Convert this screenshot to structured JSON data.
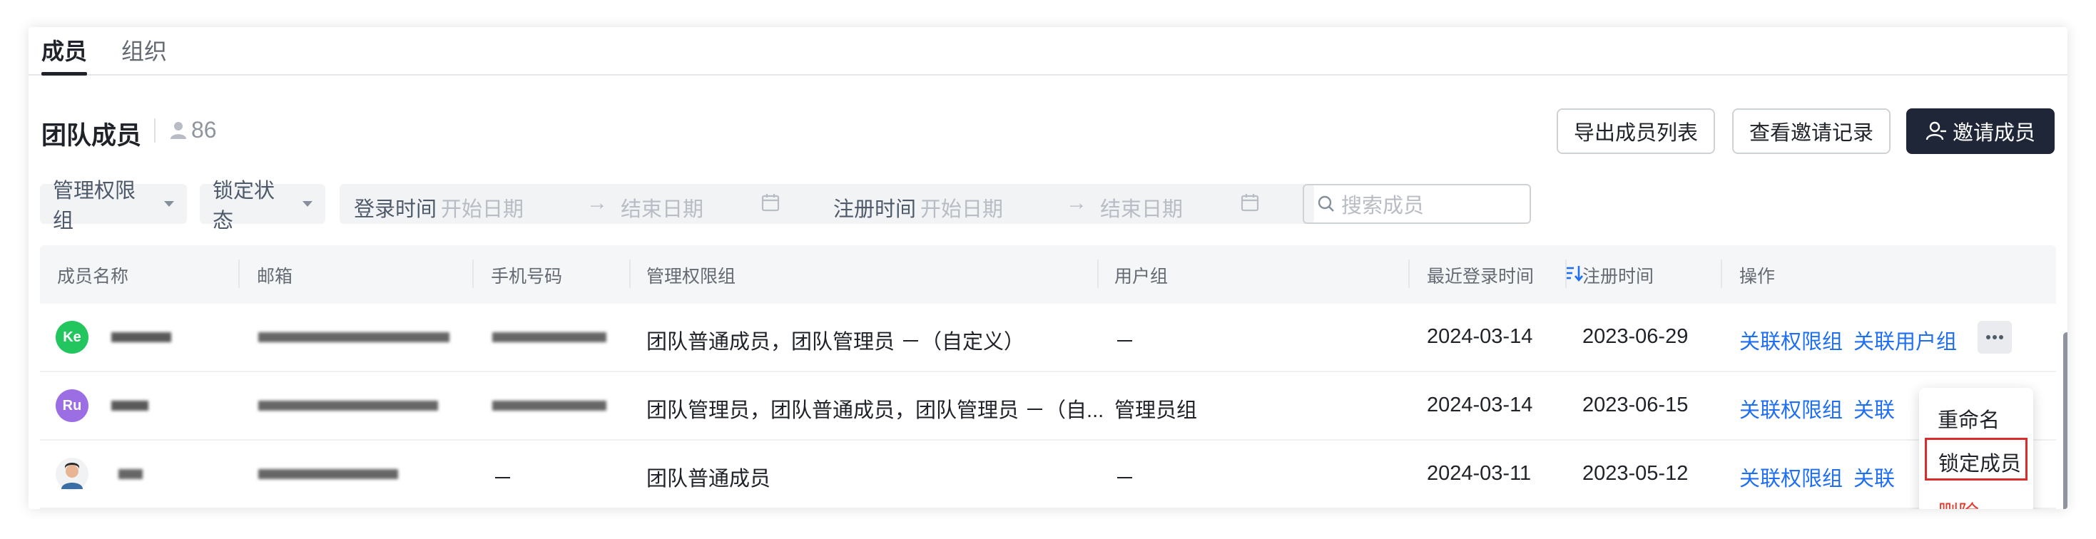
{
  "tabs": [
    {
      "label": "成员"
    },
    {
      "label": "组织"
    }
  ],
  "header": {
    "title": "团队成员",
    "member_count": "86"
  },
  "buttons": {
    "export": "导出成员列表",
    "records": "查看邀请记录",
    "invite": "邀请成员"
  },
  "filters": {
    "role": "管理权限组",
    "lock": "锁定状态",
    "login_label": "登录时间",
    "reg_label": "注册时间",
    "start_placeholder": "开始日期",
    "end_placeholder": "结束日期",
    "arrow": "→",
    "search_placeholder": "搜索成员"
  },
  "table": {
    "columns": [
      "成员名称",
      "邮箱",
      "手机号码",
      "管理权限组",
      "用户组",
      "最近登录时间",
      "注册时间",
      "操作"
    ],
    "rows": [
      {
        "avatar": "Ke",
        "avatar_color": "#22c55e",
        "phone": "",
        "roles": "团队普通成员，团队管理员 －（自定义）",
        "user_group": "－",
        "last_login": "2024-03-14",
        "registered": "2023-06-29"
      },
      {
        "avatar": "Ru",
        "avatar_color": "#9b6fe3",
        "phone": "",
        "roles": "团队管理员，团队普通成员，团队管理员 －（自...",
        "user_group": "管理员组",
        "last_login": "2024-03-14",
        "registered": "2023-06-15"
      },
      {
        "avatar": "",
        "avatar_color": "",
        "phone": "－",
        "roles": "团队普通成员",
        "user_group": "－",
        "last_login": "2024-03-11",
        "registered": "2023-05-12"
      }
    ],
    "actions": {
      "link_role": "关联权限组",
      "link_group": "关联用户组",
      "link_group_short": "关联"
    }
  },
  "menu": {
    "rename": "重命名",
    "lock": "锁定成员",
    "delete": "删除"
  },
  "colors": {
    "accent": "#1f6ff1",
    "primary_button": "#1f2637",
    "danger": "#e4392b",
    "highlight": "#d92d2d"
  }
}
